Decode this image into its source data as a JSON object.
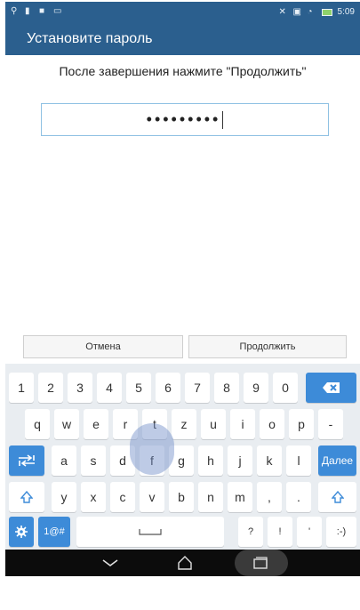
{
  "status_bar": {
    "time": "5:09",
    "left_icons": [
      "usb-icon",
      "sim-icon",
      "notification-icon",
      "screen-icon"
    ],
    "right_icons": [
      "no-sound-icon",
      "nfc-icon",
      "wifi-icon",
      "battery-icon"
    ]
  },
  "header": {
    "title": "Установите пароль"
  },
  "instruction": "После завершения нажмите \"Продолжить\"",
  "password": {
    "masked_value": "•••••••••"
  },
  "actions": {
    "cancel_label": "Отмена",
    "continue_label": "Продолжить"
  },
  "keyboard": {
    "row1": [
      "1",
      "2",
      "3",
      "4",
      "5",
      "6",
      "7",
      "8",
      "9",
      "0"
    ],
    "row2": [
      "q",
      "w",
      "e",
      "r",
      "t",
      "z",
      "u",
      "i",
      "o",
      "p",
      "-"
    ],
    "row3": [
      "a",
      "s",
      "d",
      "f",
      "g",
      "h",
      "j",
      "k",
      "l"
    ],
    "row3_enter": "Далее",
    "row4": [
      "y",
      "x",
      "c",
      "v",
      "b",
      "n",
      "m",
      ",",
      "."
    ],
    "row5": {
      "sym_label": "1@#",
      "question": "?",
      "exclaim": "!",
      "apostrophe": "'",
      "smiley": ":-)"
    },
    "colors": {
      "accent": "#3d8bd8",
      "key": "#ffffff",
      "background": "#e9edf1"
    }
  },
  "nav_bar": {
    "icons": [
      "back-icon",
      "home-icon",
      "recents-icon"
    ]
  },
  "colors": {
    "title_bar": "#2b5f8e",
    "field_border": "#8fc1e3"
  }
}
